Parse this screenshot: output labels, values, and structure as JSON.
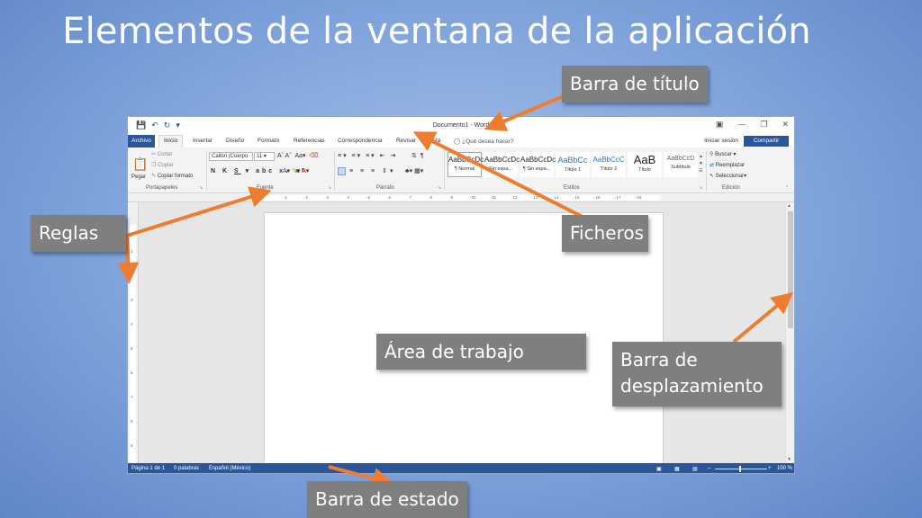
{
  "slide": {
    "title": "Elementos de la ventana de la aplicación"
  },
  "callouts": {
    "barra_titulo": "Barra de título",
    "reglas": "Reglas",
    "ficheros": "Ficheros",
    "area_trabajo": "Área de trabajo",
    "barra_desplazamiento_1": "Barra de",
    "barra_desplazamiento_2": "desplazamiento",
    "barra_estado": "Barra de estado"
  },
  "colors": {
    "callout_bg": "#7f7f7f",
    "arrow": "#ed7d31",
    "word_blue": "#2b579a"
  },
  "word": {
    "title": "Documento1 - Word",
    "tabs": {
      "archivo": "Archivo",
      "inicio": "Inicio",
      "insertar": "Insertar",
      "diseno": "Diseño",
      "formato": "Formato",
      "referencias": "Referencias",
      "correspondencia": "Correspondencia",
      "revisar": "Revisar",
      "vista": "Vista"
    },
    "tell_me": "¿Qué desea hacer?",
    "signin": "Iniciar sesión",
    "share": "Compartir",
    "ribbon": {
      "pegar": "Pegar",
      "cortar": "Cortar",
      "copiar": "Copiar",
      "copiar_formato": "Copiar formato",
      "font_name": "Calibri (Cuerpo",
      "font_size": "11",
      "buscar": "Buscar",
      "reemplazar": "Reemplazar",
      "seleccionar": "Seleccionar",
      "groups": {
        "portapapeles": "Portapapeles",
        "fuente": "Fuente",
        "parrafo": "Párrafo",
        "estilos": "Estilos",
        "edicion": "Edición"
      },
      "styles": [
        {
          "sample": "AaBbCcDc",
          "name": "¶ Normal"
        },
        {
          "sample": "AaBbCcDc",
          "name": "Sin espa..."
        },
        {
          "sample": "AaBbCcDc",
          "name": "¶ Sin espa..."
        },
        {
          "sample": "AaBbCc",
          "name": "Título 1"
        },
        {
          "sample": "AaBbCcC",
          "name": "Título 2"
        },
        {
          "sample": "AaB",
          "name": "Título"
        },
        {
          "sample": "AaBbCcD",
          "name": "Subtítulo"
        }
      ]
    },
    "status": {
      "page": "Página 1 de 1",
      "words": "0 palabras",
      "language": "Español (México)",
      "zoom": "100 %"
    }
  }
}
